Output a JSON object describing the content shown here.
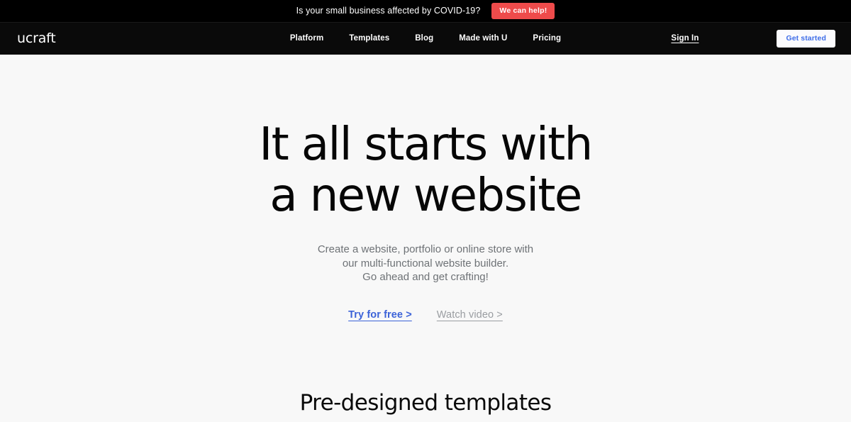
{
  "banner": {
    "message": "Is your small business affected by COVID-19?",
    "cta_label": "We can help!",
    "cta_color": "#ee4b4b",
    "background": "#000000"
  },
  "navbar": {
    "logo": "ucraft",
    "background": "#0a0a0a",
    "links": [
      {
        "label": "Platform"
      },
      {
        "label": "Templates"
      },
      {
        "label": "Blog"
      },
      {
        "label": "Made with U"
      },
      {
        "label": "Pricing"
      }
    ],
    "sign_in_label": "Sign In",
    "get_started_label": "Get started",
    "get_started_text_color": "#3f6ee8"
  },
  "hero": {
    "title_line1": "It all starts with",
    "title_line2": "a new website",
    "subtitle_line1": "Create a website, portfolio or online store with",
    "subtitle_line2": "our multi-functional website builder.",
    "subtitle_line3": "Go ahead and get crafting!",
    "primary_cta": "Try for free >",
    "secondary_cta": "Watch video >",
    "primary_cta_color": "#3c63d8",
    "secondary_cta_color": "#9a9da1"
  },
  "templates": {
    "section_title": "Pre-designed templates"
  },
  "page": {
    "background": "#f8f8f8"
  }
}
